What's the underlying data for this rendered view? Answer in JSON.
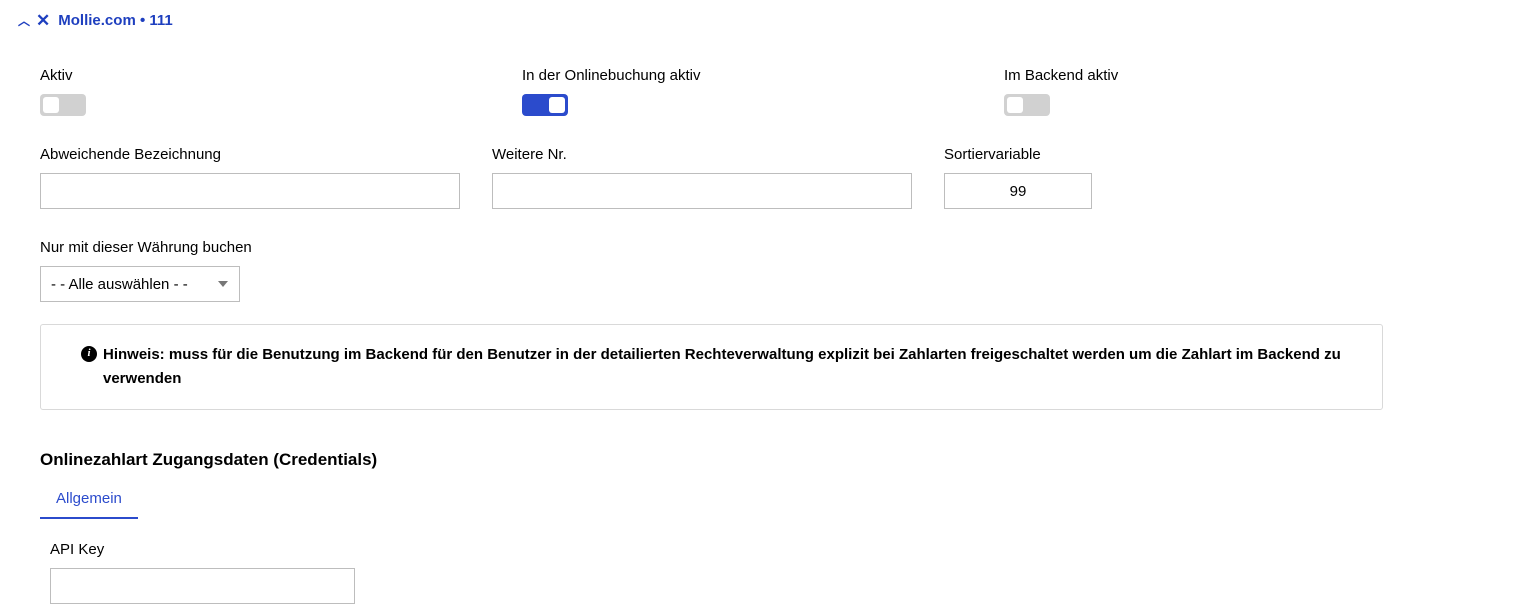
{
  "header": {
    "title": "Mollie.com • 111"
  },
  "fields": {
    "aktiv": {
      "label": "Aktiv",
      "value": false
    },
    "online": {
      "label": "In der Onlinebuchung aktiv",
      "value": true
    },
    "backend": {
      "label": "Im Backend aktiv",
      "value": false
    },
    "abweichende": {
      "label": "Abweichende Bezeichnung",
      "value": ""
    },
    "weitere": {
      "label": "Weitere Nr.",
      "value": ""
    },
    "sortier": {
      "label": "Sortiervariable",
      "value": "99"
    },
    "waehrung": {
      "label": "Nur mit dieser Währung buchen",
      "selected": "- - Alle auswählen - -"
    }
  },
  "notice": {
    "label": "Hinweis:",
    "text": "muss für die Benutzung im Backend für den Benutzer in der detailierten Rechteverwaltung explizit bei Zahlarten freigeschaltet werden um die Zahlart im Backend zu verwenden"
  },
  "credentials": {
    "title": "Onlinezahlart Zugangsdaten (Credentials)",
    "tab": "Allgemein",
    "apikey": {
      "label": "API Key",
      "value": ""
    }
  }
}
